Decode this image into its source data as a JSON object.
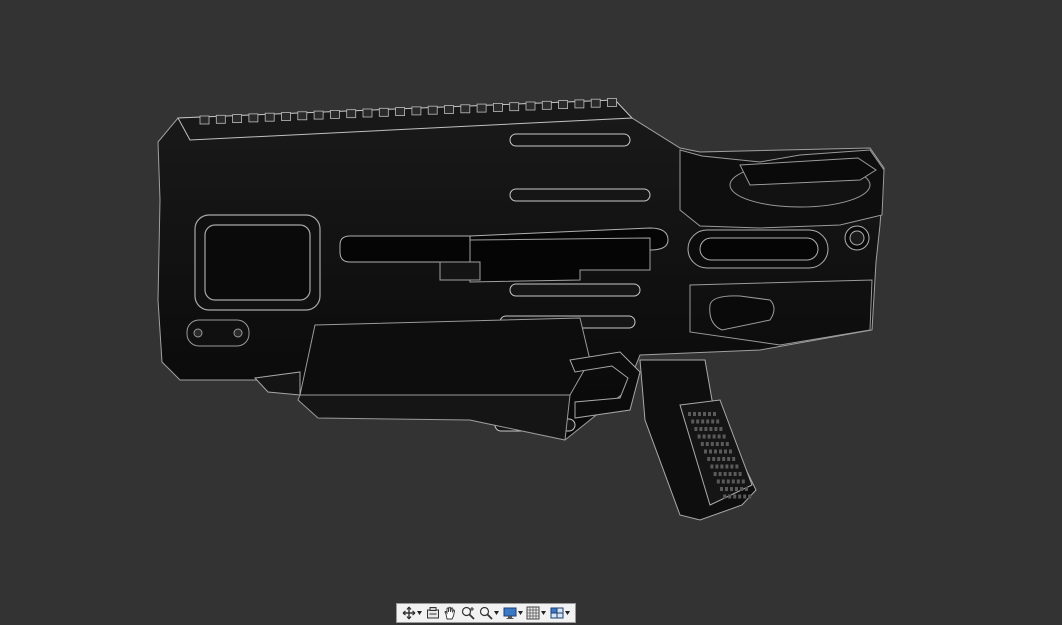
{
  "viewport": {
    "background": "#333333",
    "model_fill": "#0b0b0b",
    "model_edge": "#9a9a9a",
    "model_highlight": "#d8d8d8"
  },
  "toolbar": {
    "background": "#f2f2f2",
    "border": "#9a9a9a",
    "tools": [
      {
        "id": "orbit",
        "icon": "orbit-icon",
        "has_dropdown": true
      },
      {
        "id": "pan-view",
        "icon": "look-at-icon",
        "has_dropdown": false
      },
      {
        "id": "pan",
        "icon": "hand-pan-icon",
        "has_dropdown": false
      },
      {
        "id": "zoom",
        "icon": "zoom-icon",
        "has_dropdown": false
      },
      {
        "id": "zoom-window",
        "icon": "zoom-window-icon",
        "has_dropdown": true
      },
      {
        "id": "display-settings",
        "icon": "display-monitor-icon",
        "has_dropdown": true
      },
      {
        "id": "grid",
        "icon": "grid-icon",
        "has_dropdown": true
      },
      {
        "id": "viewports",
        "icon": "viewports-icon",
        "has_dropdown": true
      }
    ]
  }
}
